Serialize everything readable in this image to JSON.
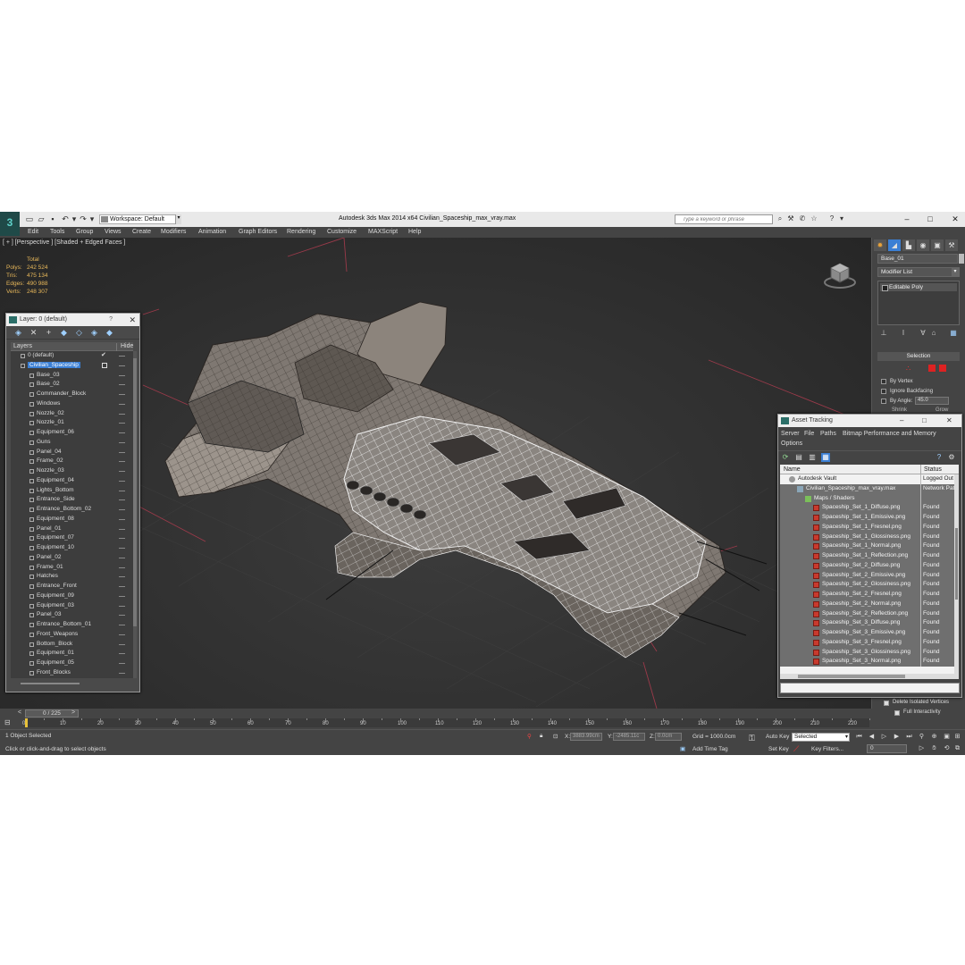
{
  "app": {
    "logo_glyph": "3",
    "workspace": "Workspace: Default",
    "title": "Autodesk 3ds Max  2014 x64     Civilian_Spaceship_max_vray.max",
    "search_placeholder": "Type a keyword or phrase"
  },
  "menu": [
    "Edit",
    "Tools",
    "Group",
    "Views",
    "Create",
    "Modifiers",
    "Animation",
    "Graph Editors",
    "Rendering",
    "Customize",
    "MAXScript",
    "Help"
  ],
  "viewport": {
    "label": "[ + ] [Perspective ] [Shaded + Edged Faces ]",
    "stats": {
      "header": "Total",
      "rows": [
        {
          "label": "Polys:",
          "value": "242 524"
        },
        {
          "label": "Tris:",
          "value": "475 134"
        },
        {
          "label": "Edges:",
          "value": "490 988"
        },
        {
          "label": "Verts:",
          "value": "248 307"
        }
      ]
    }
  },
  "layer_panel": {
    "title": "Layer: 0 (default)",
    "col_layers": "Layers",
    "col_hide": "Hide",
    "layers": [
      "0 (default)",
      "Civilian_Spaceship",
      "Base_03",
      "Base_02",
      "Commander_Block",
      "Windows",
      "Nozzle_02",
      "Nozzle_01",
      "Equipment_06",
      "Guns",
      "Panel_04",
      "Frame_02",
      "Nozzle_03",
      "Equipment_04",
      "Lights_Bottom",
      "Entrance_Side",
      "Entrance_Bottom_02",
      "Equipment_08",
      "Panel_01",
      "Equipment_07",
      "Equipment_10",
      "Panel_02",
      "Frame_01",
      "Hatches",
      "Entrance_Front",
      "Equipment_09",
      "Equipment_03",
      "Panel_03",
      "Entrance_Bottom_01",
      "Front_Weapons",
      "Bottom_Block",
      "Equipment_01",
      "Equipment_05",
      "Front_Blocks"
    ]
  },
  "command_panel": {
    "object_name": "Base_01",
    "modifier_list": "Modifier List",
    "stack_item": "Editable Poly",
    "selection_title": "Selection",
    "by_vertex": "By Vertex",
    "ignore_backfacing": "Ignore Backfacing",
    "by_angle": "By Angle:",
    "angle_value": "45.0",
    "shrink": "Shrink",
    "grow": "Grow",
    "delete_isolated": "Delete Isolated Vertices",
    "full_interactivity": "Full Interactivity"
  },
  "asset_tracking": {
    "title": "Asset Tracking",
    "menu": [
      "Server",
      "File",
      "Paths",
      "Bitmap Performance and Memory",
      "Options"
    ],
    "col_name": "Name",
    "col_status": "Status",
    "rows": [
      {
        "name": "Autodesk Vault",
        "status": "Logged Out",
        "icon": "vault",
        "indent": 0
      },
      {
        "name": "Civilian_Spaceship_max_vray.max",
        "status": "Network Path",
        "icon": "file",
        "indent": 1
      },
      {
        "name": "Maps / Shaders",
        "status": "",
        "icon": "fold",
        "indent": 2
      },
      {
        "name": "Spaceship_Set_1_Diffuse.png",
        "status": "Found",
        "icon": "img",
        "indent": 3
      },
      {
        "name": "Spaceship_Set_1_Emissive.png",
        "status": "Found",
        "icon": "img",
        "indent": 3
      },
      {
        "name": "Spaceship_Set_1_Fresnel.png",
        "status": "Found",
        "icon": "img",
        "indent": 3
      },
      {
        "name": "Spaceship_Set_1_Glossiness.png",
        "status": "Found",
        "icon": "img",
        "indent": 3
      },
      {
        "name": "Spaceship_Set_1_Normal.png",
        "status": "Found",
        "icon": "img",
        "indent": 3
      },
      {
        "name": "Spaceship_Set_1_Reflection.png",
        "status": "Found",
        "icon": "img",
        "indent": 3
      },
      {
        "name": "Spaceship_Set_2_Diffuse.png",
        "status": "Found",
        "icon": "img",
        "indent": 3
      },
      {
        "name": "Spaceship_Set_2_Emissive.png",
        "status": "Found",
        "icon": "img",
        "indent": 3
      },
      {
        "name": "Spaceship_Set_2_Glossiness.png",
        "status": "Found",
        "icon": "img",
        "indent": 3
      },
      {
        "name": "Spaceship_Set_2_Fresnel.png",
        "status": "Found",
        "icon": "img",
        "indent": 3
      },
      {
        "name": "Spaceship_Set_2_Normal.png",
        "status": "Found",
        "icon": "img",
        "indent": 3
      },
      {
        "name": "Spaceship_Set_2_Reflection.png",
        "status": "Found",
        "icon": "img",
        "indent": 3
      },
      {
        "name": "Spaceship_Set_3_Diffuse.png",
        "status": "Found",
        "icon": "img",
        "indent": 3
      },
      {
        "name": "Spaceship_Set_3_Emissive.png",
        "status": "Found",
        "icon": "img",
        "indent": 3
      },
      {
        "name": "Spaceship_Set_3_Fresnel.png",
        "status": "Found",
        "icon": "img",
        "indent": 3
      },
      {
        "name": "Spaceship_Set_3_Glossiness.png",
        "status": "Found",
        "icon": "img",
        "indent": 3
      },
      {
        "name": "Spaceship_Set_3_Normal.png",
        "status": "Found",
        "icon": "img",
        "indent": 3
      }
    ]
  },
  "timeline": {
    "slider": "0 / 225",
    "prev": "<",
    "next": ">",
    "ticks": [
      "0",
      "10",
      "20",
      "30",
      "40",
      "50",
      "60",
      "70",
      "80",
      "90",
      "100",
      "110",
      "120",
      "130",
      "140",
      "150",
      "160",
      "170",
      "180",
      "190",
      "200",
      "210",
      "220"
    ]
  },
  "status": {
    "selected": "1 Object Selected",
    "prompt": "Click or click-and-drag to select objects",
    "x_label": "X:",
    "x_value": "3883.99cm",
    "y_label": "Y:",
    "y_value": "-2485.11c",
    "z_label": "Z:",
    "z_value": "0.0cm",
    "grid": "Grid = 1000.0cm",
    "add_time_tag": "Add Time Tag",
    "auto_key": "Auto Key",
    "set_key": "Set Key",
    "key_mode": "Selected",
    "key_filters": "Key Filters...",
    "frame": "0"
  },
  "colors": {
    "accent": "#3b7fd4",
    "stats_text": "#e8b85a",
    "time_cursor": "#e8c23a",
    "missing_icon": "#c83a2e"
  }
}
